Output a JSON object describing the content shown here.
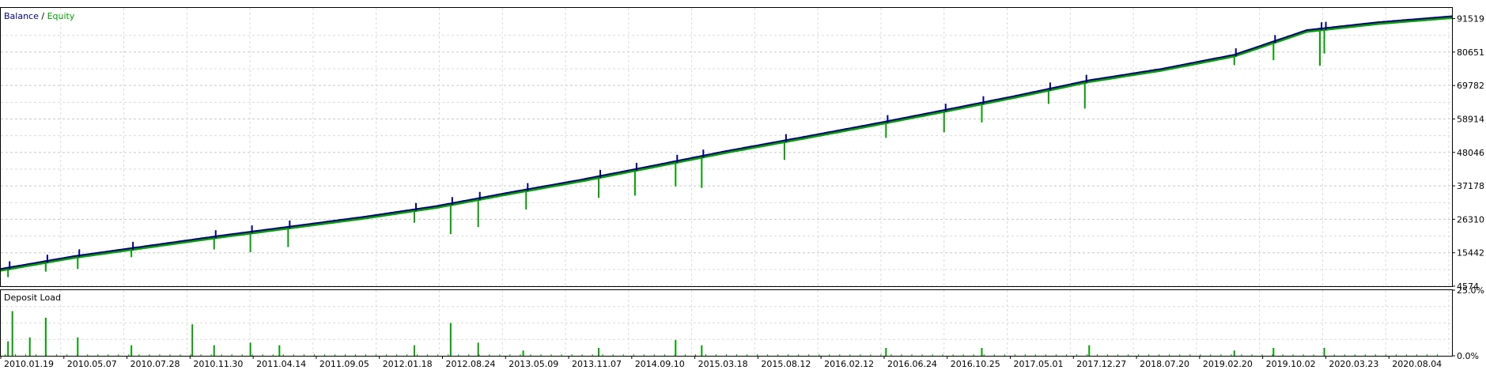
{
  "chart_data": [
    {
      "type": "line",
      "legend": {
        "items": [
          {
            "name": "Balance",
            "color": "#000080"
          },
          {
            "name": "Equity",
            "color": "#00a000"
          }
        ],
        "separator": " / ",
        "placement": "top-left"
      },
      "ylim": [
        4574,
        95000
      ],
      "y_ticks": [
        91519,
        80651,
        69782,
        58914,
        48046,
        37178,
        26310,
        15442,
        4574
      ],
      "grid": true,
      "series": [
        {
          "name": "Balance",
          "color": "#000080",
          "x": [
            0,
            0.05,
            0.1,
            0.15,
            0.2,
            0.25,
            0.3,
            0.35,
            0.4,
            0.45,
            0.5,
            0.55,
            0.6,
            0.65,
            0.7,
            0.75,
            0.8,
            0.85,
            0.9,
            0.95,
            1.0
          ],
          "values": [
            10200,
            14300,
            17600,
            20900,
            24000,
            27100,
            30600,
            35000,
            39200,
            43800,
            48500,
            52800,
            57200,
            61800,
            66500,
            71500,
            75200,
            79800,
            87800,
            90400,
            92300
          ]
        },
        {
          "name": "Equity",
          "color": "#00a000",
          "drawdowns": [
            {
              "x": 0.005,
              "low": 7500
            },
            {
              "x": 0.031,
              "low": 9300
            },
            {
              "x": 0.053,
              "low": 10200
            },
            {
              "x": 0.09,
              "low": 14000
            },
            {
              "x": 0.147,
              "low": 16500
            },
            {
              "x": 0.172,
              "low": 15600
            },
            {
              "x": 0.198,
              "low": 17300
            },
            {
              "x": 0.285,
              "low": 25200
            },
            {
              "x": 0.31,
              "low": 21500
            },
            {
              "x": 0.329,
              "low": 23800
            },
            {
              "x": 0.362,
              "low": 29500
            },
            {
              "x": 0.412,
              "low": 33300
            },
            {
              "x": 0.437,
              "low": 34000
            },
            {
              "x": 0.465,
              "low": 37000
            },
            {
              "x": 0.483,
              "low": 36500
            },
            {
              "x": 0.54,
              "low": 45600
            },
            {
              "x": 0.61,
              "low": 52800
            },
            {
              "x": 0.65,
              "low": 54600
            },
            {
              "x": 0.676,
              "low": 57800
            },
            {
              "x": 0.722,
              "low": 63800
            },
            {
              "x": 0.747,
              "low": 62300
            },
            {
              "x": 0.85,
              "low": 76400
            },
            {
              "x": 0.877,
              "low": 78000
            },
            {
              "x": 0.909,
              "low": 76200
            },
            {
              "x": 0.912,
              "low": 80200
            }
          ]
        },
        {
          "name": "Deposit Load",
          "color": "#00a000",
          "ylim": [
            0,
            25
          ],
          "y_ticks": [
            "25.0%",
            "0.0%"
          ],
          "spikes": [
            {
              "x": 0.005,
              "v": 5.5
            },
            {
              "x": 0.008,
              "v": 17
            },
            {
              "x": 0.02,
              "v": 7
            },
            {
              "x": 0.031,
              "v": 14.5
            },
            {
              "x": 0.053,
              "v": 7
            },
            {
              "x": 0.09,
              "v": 4
            },
            {
              "x": 0.132,
              "v": 12
            },
            {
              "x": 0.147,
              "v": 4
            },
            {
              "x": 0.172,
              "v": 5
            },
            {
              "x": 0.192,
              "v": 4
            },
            {
              "x": 0.285,
              "v": 4
            },
            {
              "x": 0.31,
              "v": 12.5
            },
            {
              "x": 0.329,
              "v": 5
            },
            {
              "x": 0.36,
              "v": 2
            },
            {
              "x": 0.412,
              "v": 3
            },
            {
              "x": 0.465,
              "v": 6
            },
            {
              "x": 0.483,
              "v": 4
            },
            {
              "x": 0.61,
              "v": 3
            },
            {
              "x": 0.676,
              "v": 3
            },
            {
              "x": 0.75,
              "v": 4
            },
            {
              "x": 0.85,
              "v": 2
            },
            {
              "x": 0.877,
              "v": 3
            },
            {
              "x": 0.912,
              "v": 3
            }
          ]
        }
      ],
      "x_tick_labels": [
        "2010.01.19",
        "2010.05.07",
        "2010.07.28",
        "2010.11.30",
        "2011.04.14",
        "2011.09.05",
        "2012.01.18",
        "2012.08.24",
        "2013.05.09",
        "2013.11.07",
        "2014.09.10",
        "2015.03.18",
        "2015.08.12",
        "2016.02.12",
        "2016.06.24",
        "2016.10.25",
        "2017.05.01",
        "2017.12.27",
        "2018.07.20",
        "2019.02.20",
        "2019.10.02",
        "2020.03.23",
        "2020.08.04"
      ],
      "panels": [
        {
          "title": "",
          "kind": "balance-equity"
        },
        {
          "title": "Deposit Load",
          "kind": "deposit-load"
        }
      ]
    }
  ]
}
